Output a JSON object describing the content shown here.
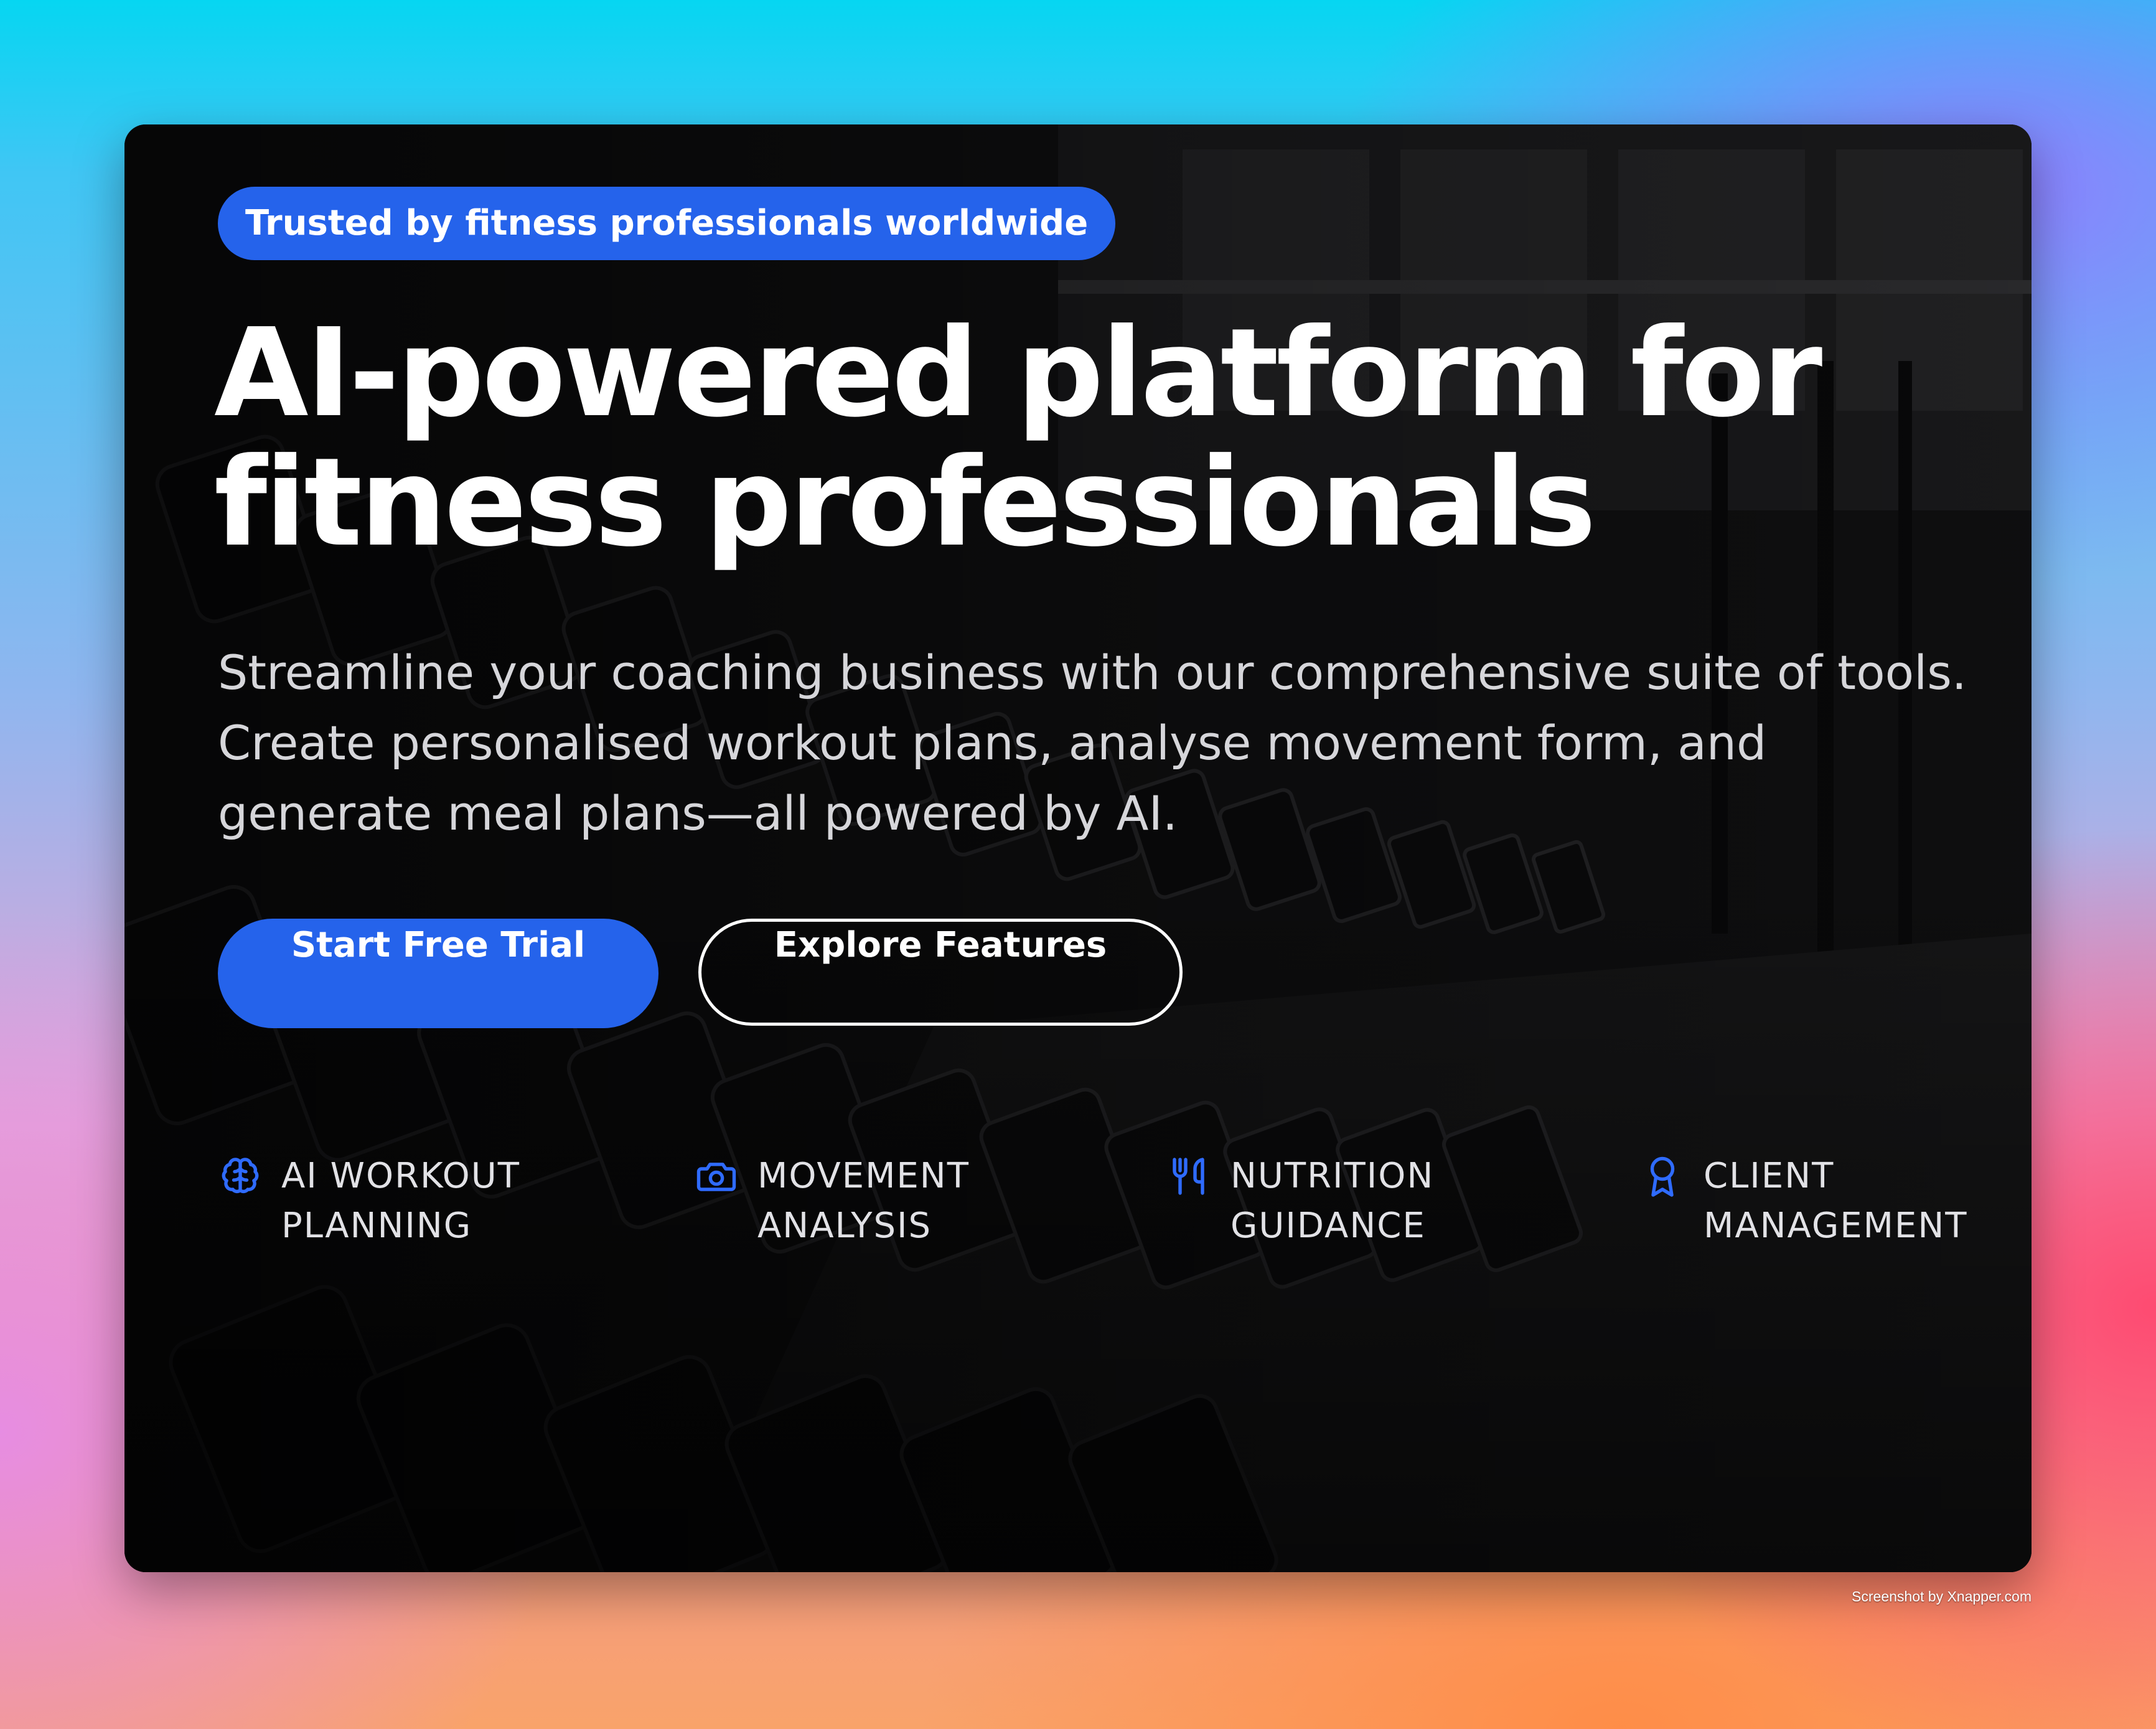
{
  "hero": {
    "badge": "Trusted by fitness professionals worldwide",
    "headline": {
      "line1": "AI-powered platform for",
      "line2": "fitness professionals"
    },
    "subtitle": {
      "line1": "Streamline your coaching business with our comprehensive suite of tools.",
      "line2": "Create personalised workout plans, analyse movement form, and",
      "line3": "generate meal plans—all powered by AI."
    },
    "buttons": {
      "primary_label": "Start Free Trial",
      "secondary_label": "Explore Features"
    }
  },
  "features": [
    {
      "icon": "brain-icon",
      "line1": "AI WORKOUT",
      "line2": "PLANNING"
    },
    {
      "icon": "camera-icon",
      "line1": "MOVEMENT",
      "line2": "ANALYSIS"
    },
    {
      "icon": "utensils-icon",
      "line1": "NUTRITION",
      "line2": "GUIDANCE"
    },
    {
      "icon": "award-icon",
      "line1": "CLIENT",
      "line2": "MANAGEMENT"
    }
  ],
  "watermark": "Screenshot by Xnapper.com",
  "colors": {
    "accent": "#2563eb",
    "card_background": "#0b0b0c",
    "text_primary": "#ffffff",
    "text_secondary": "#d6d6da"
  }
}
